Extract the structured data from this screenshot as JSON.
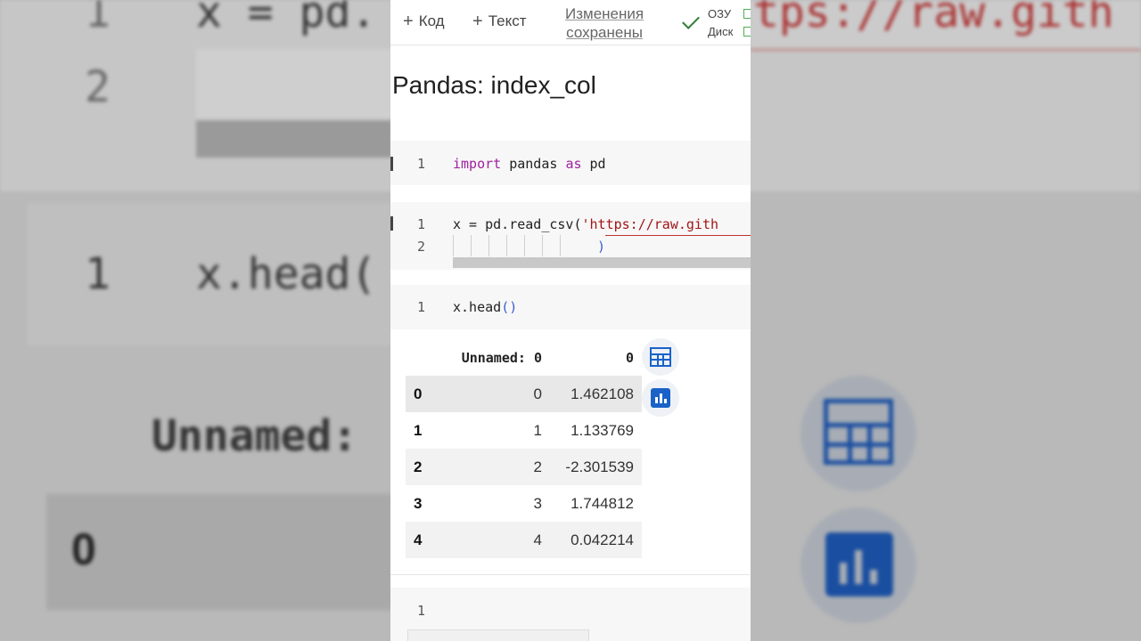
{
  "background": {
    "line1_num": "1",
    "line1_code": "x = pd.",
    "line2_num": "2",
    "head_num": "1",
    "head_code": "x.head(",
    "unnamed": "Unnamed:",
    "row0": "0",
    "url_fragment": "tps://raw.gith"
  },
  "toolbar": {
    "add_code": "Код",
    "add_text": "Текст",
    "saved_line1": "Изменения",
    "saved_line2": "сохранены",
    "ram": "ОЗУ",
    "disk": "Диск"
  },
  "heading": "Pandas: index_col",
  "cells": [
    {
      "line": "1",
      "kw1": "import",
      "mid": " pandas ",
      "kw2": "as",
      "end": " pd"
    },
    {
      "line1": "1",
      "code1_pre": "x = pd.read_csv(",
      "code1_str": "'https://raw.gith",
      "line2": "2",
      "code2": ")"
    },
    {
      "line": "1",
      "code_pre": "x.head",
      "code_paren": "()"
    }
  ],
  "dataframe": {
    "columns": [
      "Unnamed: 0",
      "0"
    ],
    "rows": [
      {
        "index": "0",
        "c1": "0",
        "c2": "1.462108"
      },
      {
        "index": "1",
        "c1": "1",
        "c2": "1.133769"
      },
      {
        "index": "2",
        "c1": "2",
        "c2": "-2.301539"
      },
      {
        "index": "3",
        "c1": "3",
        "c2": "1.744812"
      },
      {
        "index": "4",
        "c1": "4",
        "c2": "0.042214"
      }
    ]
  },
  "empty_cell_line": "1",
  "icons": [
    "table-view-icon",
    "chart-suggest-icon"
  ],
  "colors": {
    "accent": "#1a62c8",
    "keyword": "#a020a0",
    "string": "#a31515"
  }
}
